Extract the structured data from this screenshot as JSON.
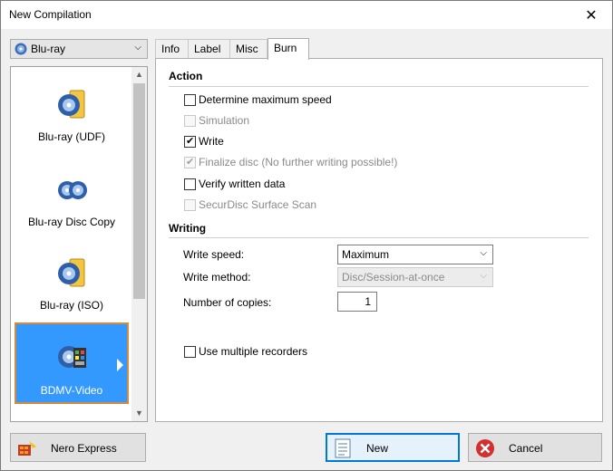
{
  "window": {
    "title": "New Compilation"
  },
  "disc_type": {
    "selected": "Blu-ray"
  },
  "disc_list": {
    "items": [
      {
        "label": "Blu-ray (UDF)",
        "icon": "bluray-udf-icon"
      },
      {
        "label": "Blu-ray Disc Copy",
        "icon": "bluray-copy-icon"
      },
      {
        "label": "Blu-ray (ISO)",
        "icon": "bluray-iso-icon"
      },
      {
        "label": "BDMV-Video",
        "icon": "bdmv-video-icon",
        "selected": true
      }
    ]
  },
  "tabs": [
    {
      "label": "Info"
    },
    {
      "label": "Label"
    },
    {
      "label": "Misc"
    },
    {
      "label": "Burn",
      "active": true
    }
  ],
  "burn": {
    "action_title": "Action",
    "options": [
      {
        "label": "Determine maximum speed",
        "checked": false,
        "enabled": true
      },
      {
        "label": "Simulation",
        "checked": false,
        "enabled": false
      },
      {
        "label": "Write",
        "checked": true,
        "enabled": true
      },
      {
        "label": "Finalize disc (No further writing possible!)",
        "checked": true,
        "enabled": false
      },
      {
        "label": "Verify written data",
        "checked": false,
        "enabled": true
      },
      {
        "label": "SecurDisc Surface Scan",
        "checked": false,
        "enabled": false
      }
    ],
    "writing_title": "Writing",
    "write_speed_label": "Write speed:",
    "write_speed_value": "Maximum",
    "write_method_label": "Write method:",
    "write_method_value": "Disc/Session-at-once",
    "copies_label": "Number of copies:",
    "copies_value": "1",
    "multi_recorder_label": "Use multiple recorders",
    "multi_recorder_checked": false
  },
  "buttons": {
    "nero_express": "Nero Express",
    "new": "New",
    "cancel": "Cancel"
  },
  "colors": {
    "accent": "#3399ff",
    "selection_border": "#d68a3a",
    "focus": "#0078d7"
  }
}
